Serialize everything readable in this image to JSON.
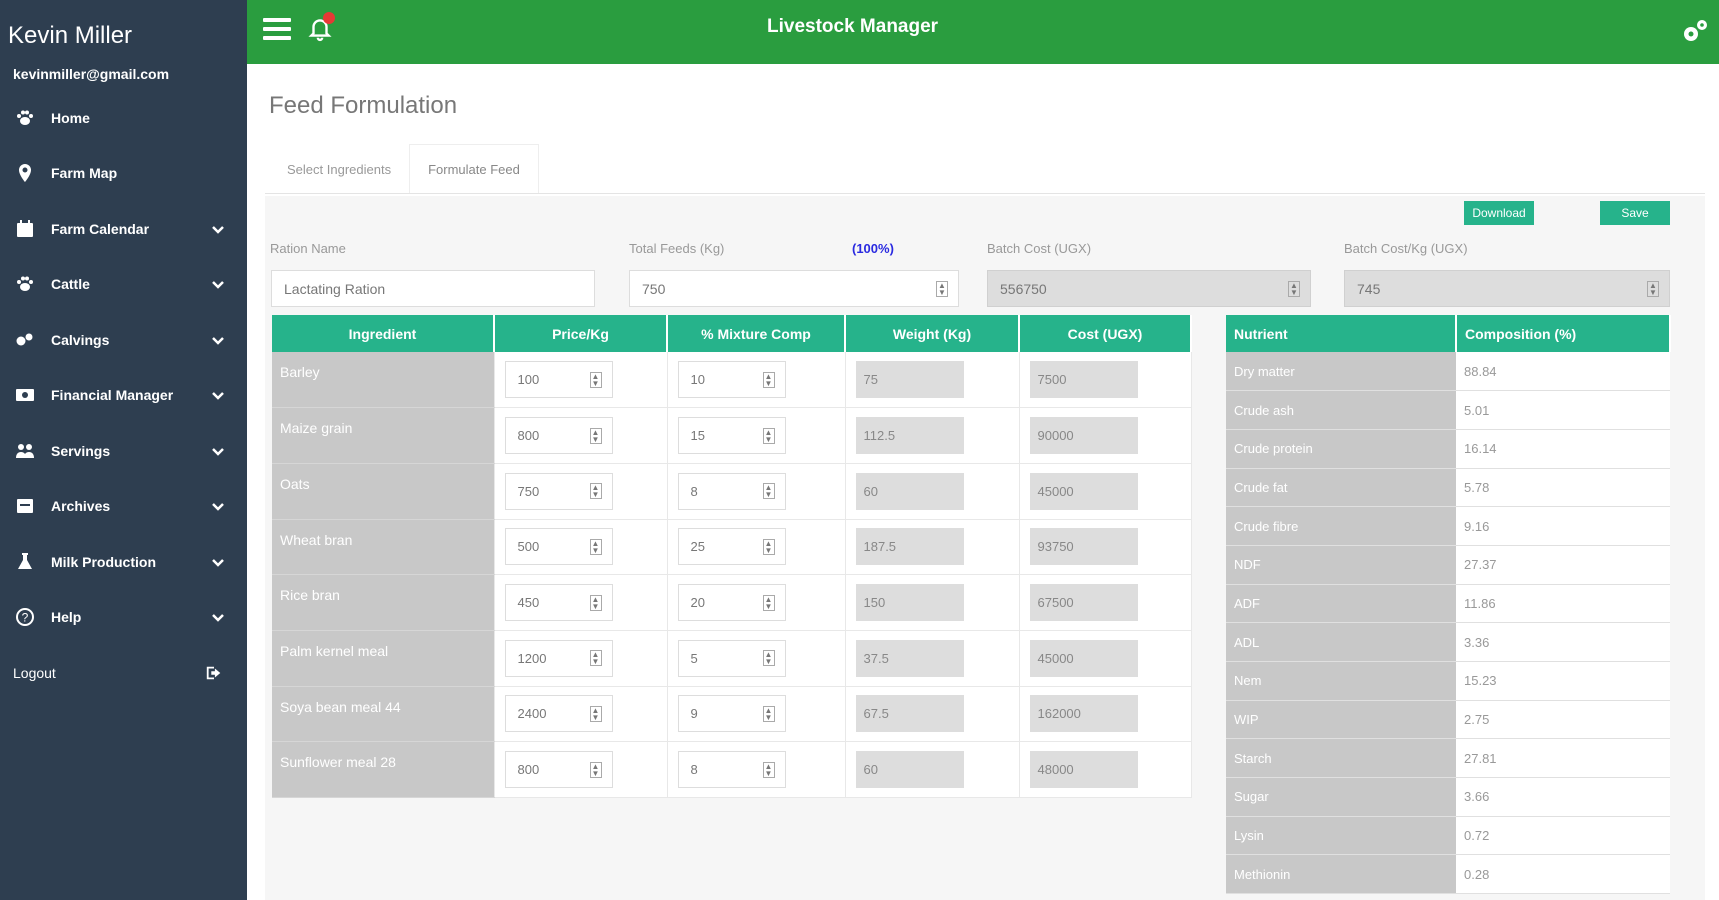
{
  "sidebar": {
    "user_name": "Kevin Miller",
    "user_email": "kevinmiller@gmail.com",
    "items": [
      {
        "label": "Home",
        "icon": "paw-icon",
        "chevron": false
      },
      {
        "label": "Farm Map",
        "icon": "map-pin-icon",
        "chevron": false
      },
      {
        "label": "Farm Calendar",
        "icon": "calendar-icon",
        "chevron": true
      },
      {
        "label": "Cattle",
        "icon": "paw-icon",
        "chevron": true
      },
      {
        "label": "Calvings",
        "icon": "calving-icon",
        "chevron": true
      },
      {
        "label": "Financial Manager",
        "icon": "money-icon",
        "chevron": true
      },
      {
        "label": "Servings",
        "icon": "group-icon",
        "chevron": true
      },
      {
        "label": "Archives",
        "icon": "archive-icon",
        "chevron": true
      },
      {
        "label": "Milk Production",
        "icon": "flask-icon",
        "chevron": true
      },
      {
        "label": "Help",
        "icon": "help-icon",
        "chevron": true
      }
    ],
    "logout_label": "Logout"
  },
  "topbar": {
    "title": "Livestock Manager"
  },
  "page": {
    "title": "Feed Formulation",
    "tabs": [
      "Select Ingredients",
      "Formulate Feed"
    ],
    "active_tab": 1
  },
  "actions": {
    "download_label": "Download",
    "save_label": "Save"
  },
  "form": {
    "ration_name_label": "Ration Name",
    "ration_name_value": "Lactating Ration",
    "total_feeds_label": "Total Feeds (Kg)",
    "total_pct": "(100%)",
    "total_feeds_value": "750",
    "batch_cost_label": "Batch Cost (UGX)",
    "batch_cost_value": "556750",
    "batch_cost_kg_label": "Batch Cost/Kg (UGX)",
    "batch_cost_kg_value": "745"
  },
  "ingredients": {
    "headers": [
      "Ingredient",
      "Price/Kg",
      "% Mixture Comp",
      "Weight (Kg)",
      "Cost (UGX)"
    ],
    "rows": [
      {
        "name": "Barley",
        "price": "100",
        "mix": "10",
        "weight": "75",
        "cost": "7500"
      },
      {
        "name": "Maize grain",
        "price": "800",
        "mix": "15",
        "weight": "112.5",
        "cost": "90000"
      },
      {
        "name": "Oats",
        "price": "750",
        "mix": "8",
        "weight": "60",
        "cost": "45000"
      },
      {
        "name": "Wheat bran",
        "price": "500",
        "mix": "25",
        "weight": "187.5",
        "cost": "93750"
      },
      {
        "name": "Rice bran",
        "price": "450",
        "mix": "20",
        "weight": "150",
        "cost": "67500"
      },
      {
        "name": "Palm kernel meal",
        "price": "1200",
        "mix": "5",
        "weight": "37.5",
        "cost": "45000"
      },
      {
        "name": "Soya bean meal 44",
        "price": "2400",
        "mix": "9",
        "weight": "67.5",
        "cost": "162000"
      },
      {
        "name": "Sunflower meal 28",
        "price": "800",
        "mix": "8",
        "weight": "60",
        "cost": "48000"
      }
    ]
  },
  "nutrients": {
    "headers": [
      "Nutrient",
      "Composition (%)"
    ],
    "rows": [
      {
        "name": "Dry matter",
        "value": "88.84"
      },
      {
        "name": "Crude ash",
        "value": "5.01"
      },
      {
        "name": "Crude protein",
        "value": "16.14"
      },
      {
        "name": "Crude fat",
        "value": "5.78"
      },
      {
        "name": "Crude fibre",
        "value": "9.16"
      },
      {
        "name": "NDF",
        "value": "27.37"
      },
      {
        "name": "ADF",
        "value": "11.86"
      },
      {
        "name": "ADL",
        "value": "3.36"
      },
      {
        "name": "Nem",
        "value": "15.23"
      },
      {
        "name": "WIP",
        "value": "2.75"
      },
      {
        "name": "Starch",
        "value": "27.81"
      },
      {
        "name": "Sugar",
        "value": "3.66"
      },
      {
        "name": "Lysin",
        "value": "0.72"
      },
      {
        "name": "Methionin",
        "value": "0.28"
      }
    ]
  },
  "colors": {
    "sidebar_bg": "#2e3e50",
    "topbar_bg": "#2a9d3f",
    "accent": "#26b38b"
  }
}
